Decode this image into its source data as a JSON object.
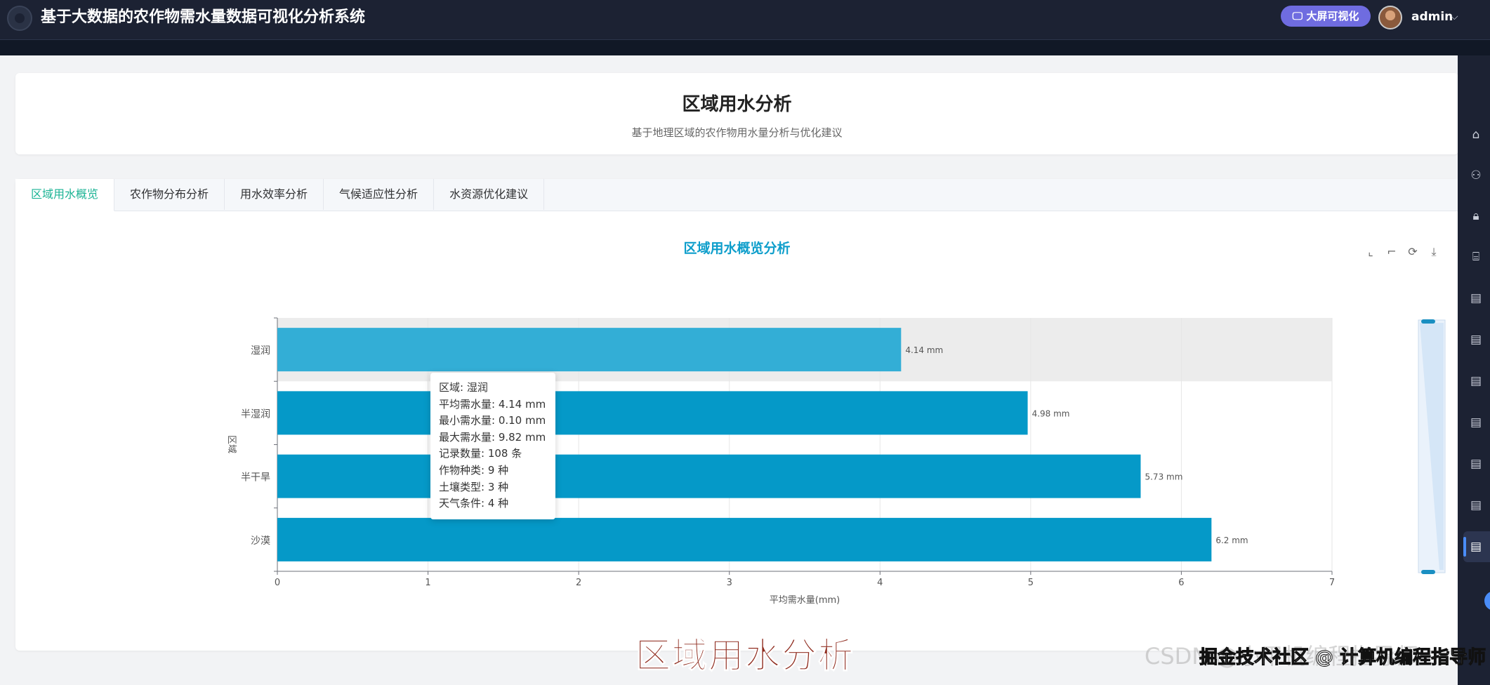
{
  "app": {
    "title": "基于大数据的农作物需水量数据可视化分析系统",
    "screen_button": "大屏可视化",
    "username": "admin",
    "caret": "⌵"
  },
  "header": {
    "title": "区域用水分析",
    "subtitle": "基于地理区域的农作物用水量分析与优化建议"
  },
  "tabs": [
    {
      "label": "区域用水概览",
      "active": true
    },
    {
      "label": "农作物分布分析",
      "active": false
    },
    {
      "label": "用水效率分析",
      "active": false
    },
    {
      "label": "气候适应性分析",
      "active": false
    },
    {
      "label": "水资源优化建议",
      "active": false
    }
  ],
  "toolbox": {
    "zoom_icon": "⌞",
    "restore_zoom_icon": "⌐",
    "refresh_icon": "⟳",
    "download_icon": "⤓"
  },
  "chart_data": {
    "type": "bar",
    "orientation": "horizontal",
    "title": "区域用水概览分析",
    "xlabel": "平均需水量(mm)",
    "ylabel": "区域",
    "categories": [
      "沙漠",
      "半干旱",
      "半湿润",
      "湿润"
    ],
    "values": [
      6.2,
      5.73,
      4.98,
      4.14
    ],
    "value_labels": [
      "6.2 mm",
      "5.73 mm",
      "4.98 mm",
      "4.14 mm"
    ],
    "xlim": [
      0,
      7
    ],
    "xticks": [
      0,
      1,
      2,
      3,
      4,
      5,
      6,
      7
    ],
    "grid": true,
    "highlighted_category": "湿润",
    "colors": {
      "bar": "#0599c8",
      "bar_highlight": "#33aed6",
      "highlight_band": "#ececec"
    }
  },
  "tooltip": {
    "lines": [
      "区域: 湿润",
      "平均需水量: 4.14 mm",
      "最小需水量: 0.10 mm",
      "最大需水量: 9.82 mm",
      "记录数量: 108 条",
      "作物种类: 9 种",
      "土壤类型: 3 种",
      "天气条件: 4 种"
    ]
  },
  "caption": "区域用水分析",
  "watermark": {
    "faded": "CSDN @小甲机编程指导师",
    "overlay": "掘金技术社区 @ 计算机编程指导师"
  },
  "rail_icons": [
    "home-icon",
    "user-icon",
    "lock-icon",
    "board-icon",
    "doc-icon",
    "doc-icon",
    "doc-icon",
    "doc-icon",
    "doc-icon",
    "doc-icon",
    "doc-icon"
  ]
}
